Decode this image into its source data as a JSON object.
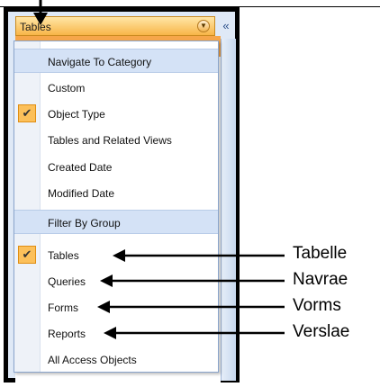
{
  "nav_pane": {
    "title": "Tables",
    "collapse_glyph": "«",
    "dropdown_icon": "chevron-down-icon"
  },
  "menu": {
    "heading_category": "Navigate To Category",
    "category_items": [
      {
        "label": "Custom",
        "checked": false
      },
      {
        "label": "Object Type",
        "checked": true
      },
      {
        "label": "Tables and Related Views",
        "checked": false
      },
      {
        "label": "Created Date",
        "checked": false
      },
      {
        "label": "Modified Date",
        "checked": false
      }
    ],
    "heading_filter": "Filter By Group",
    "filter_items": [
      {
        "label": "Tables",
        "checked": true
      },
      {
        "label": "Queries",
        "checked": false
      },
      {
        "label": "Forms",
        "checked": false
      },
      {
        "label": "Reports",
        "checked": false
      },
      {
        "label": "All Access Objects",
        "checked": false
      }
    ],
    "check_glyph": "✔"
  },
  "callouts": [
    "Tabelle",
    "Navrae",
    "Vorms",
    "Verslae"
  ]
}
